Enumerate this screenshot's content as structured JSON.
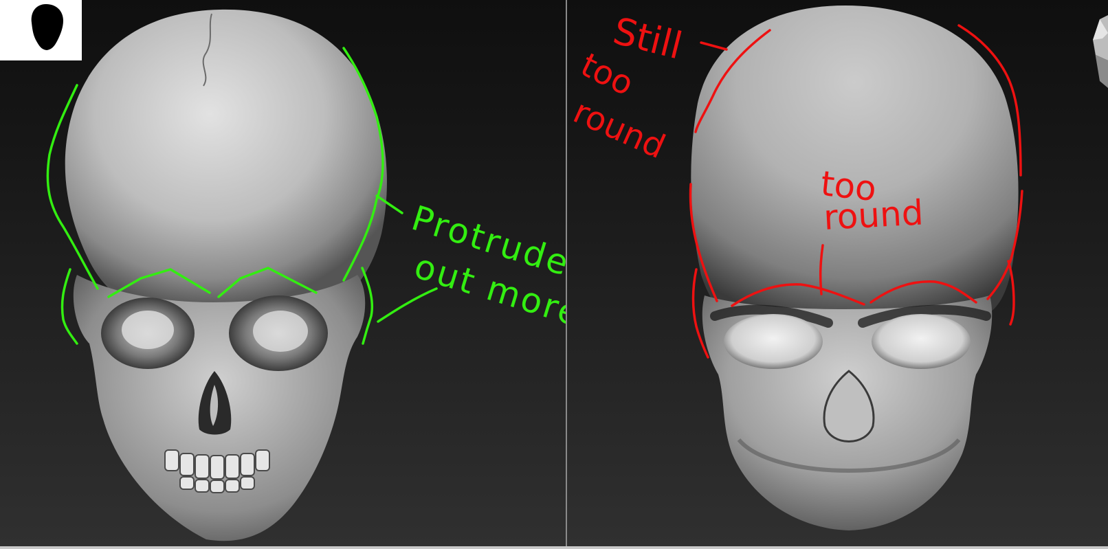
{
  "annotations": {
    "left": {
      "color": "#33ee11",
      "line1": "Protrudes",
      "line2": "out more"
    },
    "right": {
      "color": "#ee1111",
      "still": "Still",
      "too1": "too",
      "round1": "round",
      "too2": "too",
      "round2": "round"
    }
  },
  "thumbnail_icon": "head-silhouette-icon",
  "nav_cube_icon": "navigation-cube-icon",
  "colors": {
    "background_top": "#0f0f0f",
    "background_bottom": "#303030",
    "skull_light": "#d8d8d8",
    "skull_dark": "#4a4a4a"
  }
}
